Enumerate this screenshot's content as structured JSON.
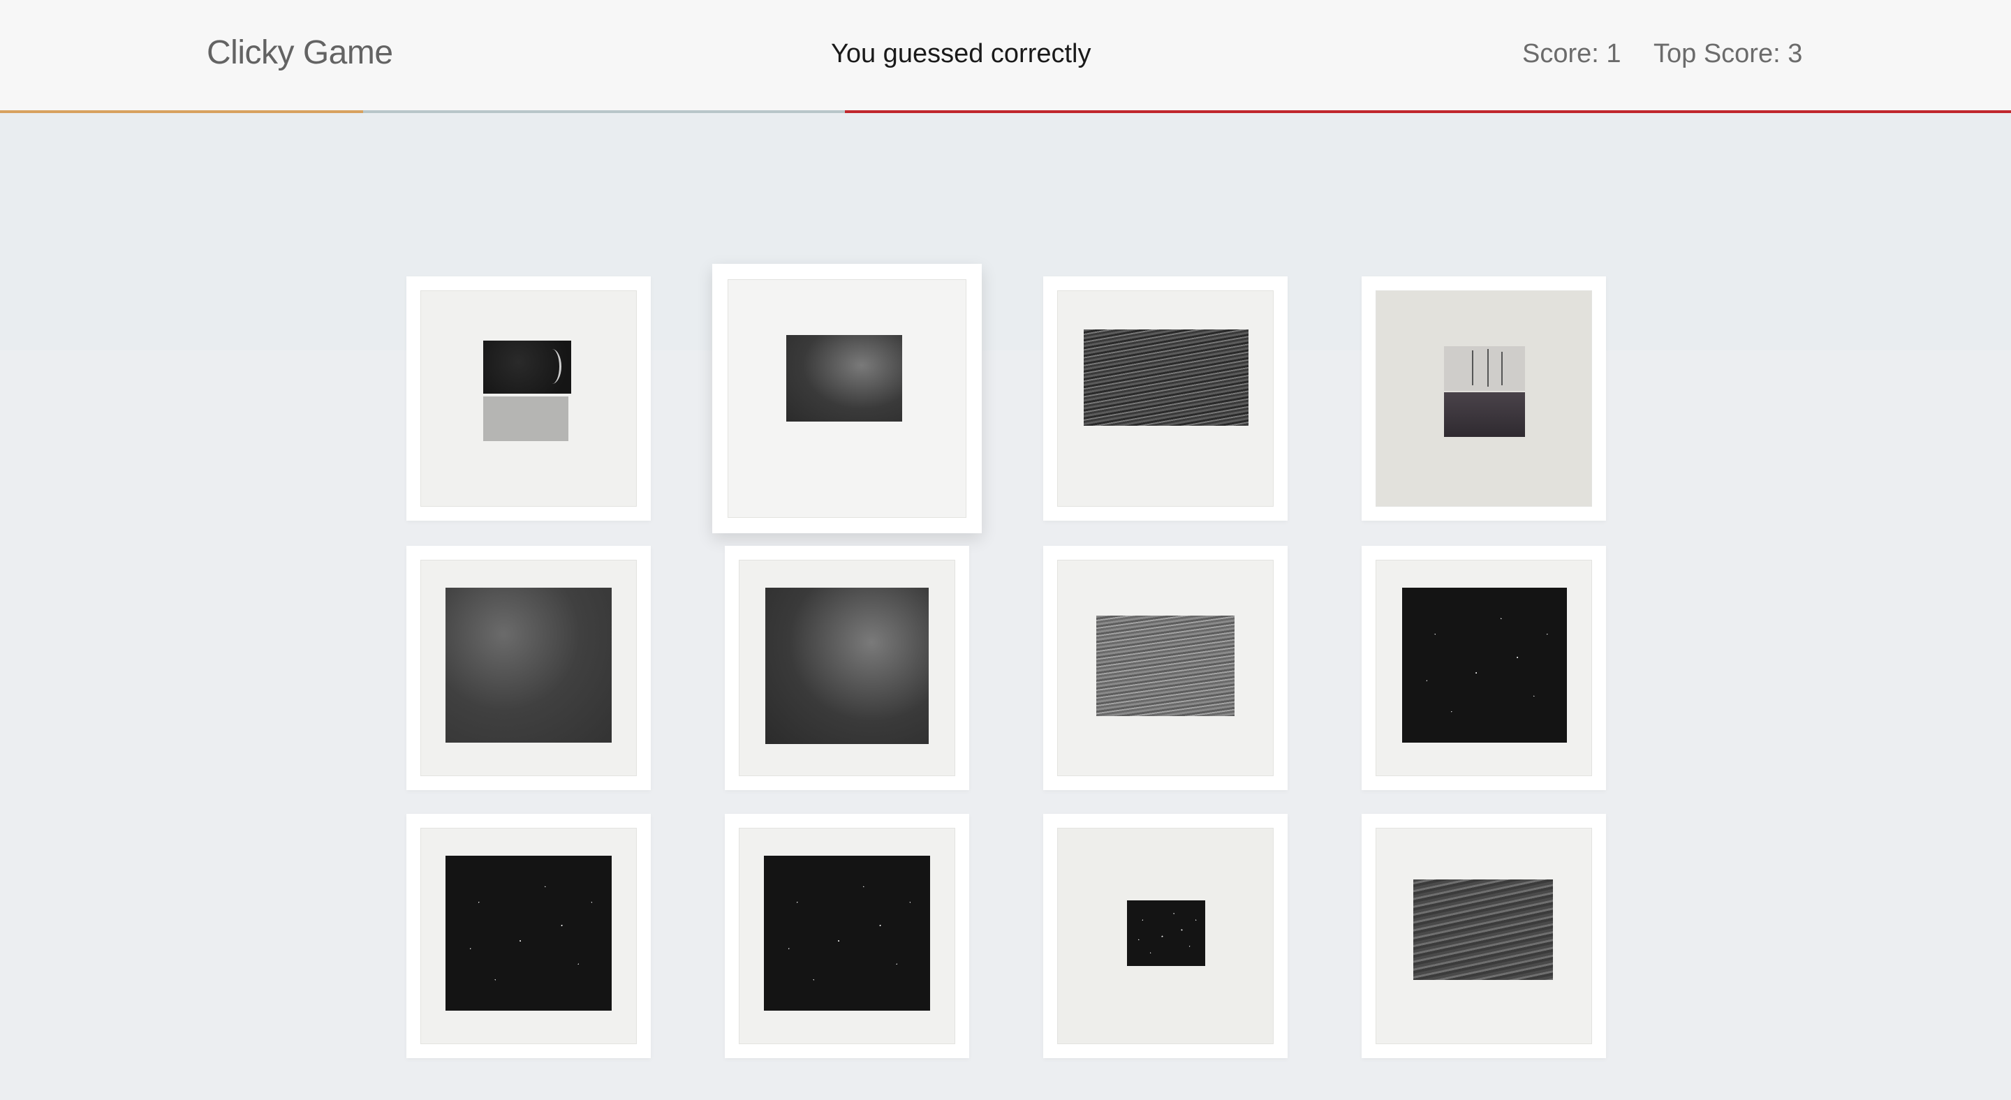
{
  "navbar": {
    "brand": "Clicky Game",
    "message": "You guessed correctly",
    "score_label": "Score: 1",
    "top_score_label": "Top Score: 3"
  },
  "accent_colors": [
    "#d9a15a",
    "#b9c9cc",
    "#c0272d"
  ],
  "cards": [
    {
      "subject": "moon-diptych-print"
    },
    {
      "subject": "gray-haze-print"
    },
    {
      "subject": "ocean-waves-print"
    },
    {
      "subject": "ship-and-stars-print"
    },
    {
      "subject": "night-sky-haze-print"
    },
    {
      "subject": "night-sky-haze-print-2"
    },
    {
      "subject": "ocean-print-small"
    },
    {
      "subject": "star-field-print"
    },
    {
      "subject": "star-field-print-2"
    },
    {
      "subject": "star-field-print-3"
    },
    {
      "subject": "small-star-field-print"
    },
    {
      "subject": "dark-ocean-print"
    }
  ]
}
